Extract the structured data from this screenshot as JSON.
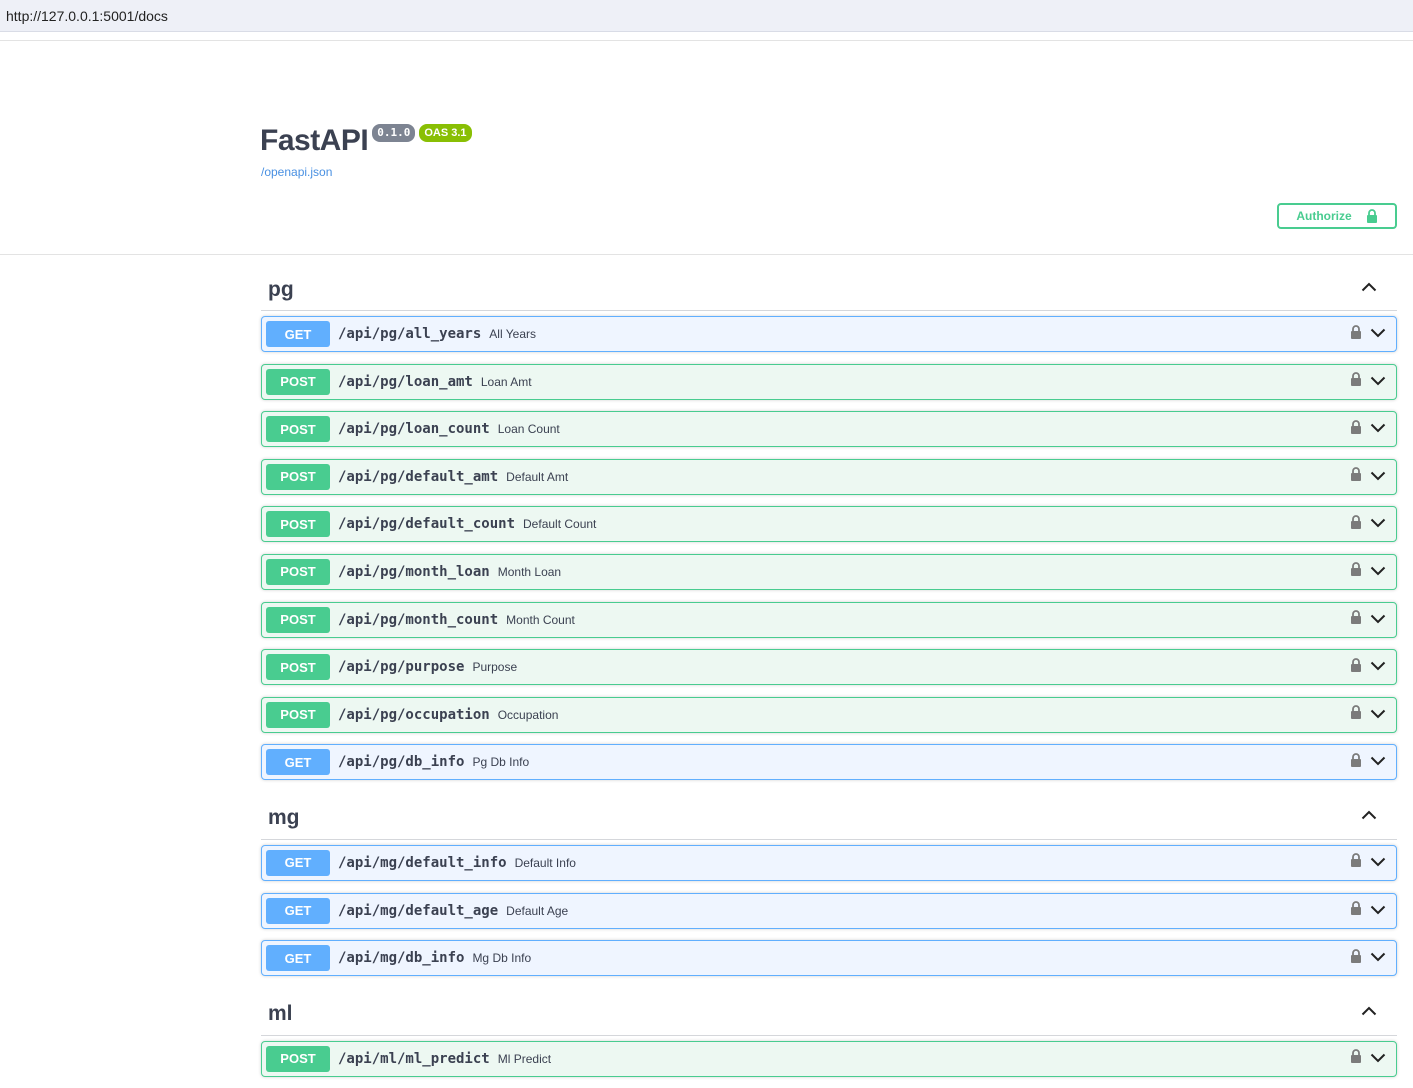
{
  "browser": {
    "url": "http://127.0.0.1:5001/docs"
  },
  "info": {
    "title": "FastAPI",
    "version": "0.1.0",
    "oas": "OAS 3.1",
    "spec_link": "/openapi.json",
    "authorize_label": "Authorize"
  },
  "colors": {
    "get": "#61affe",
    "post": "#49cc90",
    "version_badge": "#7d8492",
    "oas_badge": "#89bf04"
  },
  "tags": [
    {
      "name": "pg",
      "operations": [
        {
          "method": "GET",
          "path": "/api/pg/all_years",
          "summary": "All Years"
        },
        {
          "method": "POST",
          "path": "/api/pg/loan_amt",
          "summary": "Loan Amt"
        },
        {
          "method": "POST",
          "path": "/api/pg/loan_count",
          "summary": "Loan Count"
        },
        {
          "method": "POST",
          "path": "/api/pg/default_amt",
          "summary": "Default Amt"
        },
        {
          "method": "POST",
          "path": "/api/pg/default_count",
          "summary": "Default Count"
        },
        {
          "method": "POST",
          "path": "/api/pg/month_loan",
          "summary": "Month Loan"
        },
        {
          "method": "POST",
          "path": "/api/pg/month_count",
          "summary": "Month Count"
        },
        {
          "method": "POST",
          "path": "/api/pg/purpose",
          "summary": "Purpose"
        },
        {
          "method": "POST",
          "path": "/api/pg/occupation",
          "summary": "Occupation"
        },
        {
          "method": "GET",
          "path": "/api/pg/db_info",
          "summary": "Pg Db Info"
        }
      ]
    },
    {
      "name": "mg",
      "operations": [
        {
          "method": "GET",
          "path": "/api/mg/default_info",
          "summary": "Default Info"
        },
        {
          "method": "GET",
          "path": "/api/mg/default_age",
          "summary": "Default Age"
        },
        {
          "method": "GET",
          "path": "/api/mg/db_info",
          "summary": "Mg Db Info"
        }
      ]
    },
    {
      "name": "ml",
      "operations": [
        {
          "method": "POST",
          "path": "/api/ml/ml_predict",
          "summary": "Ml Predict"
        }
      ]
    }
  ]
}
